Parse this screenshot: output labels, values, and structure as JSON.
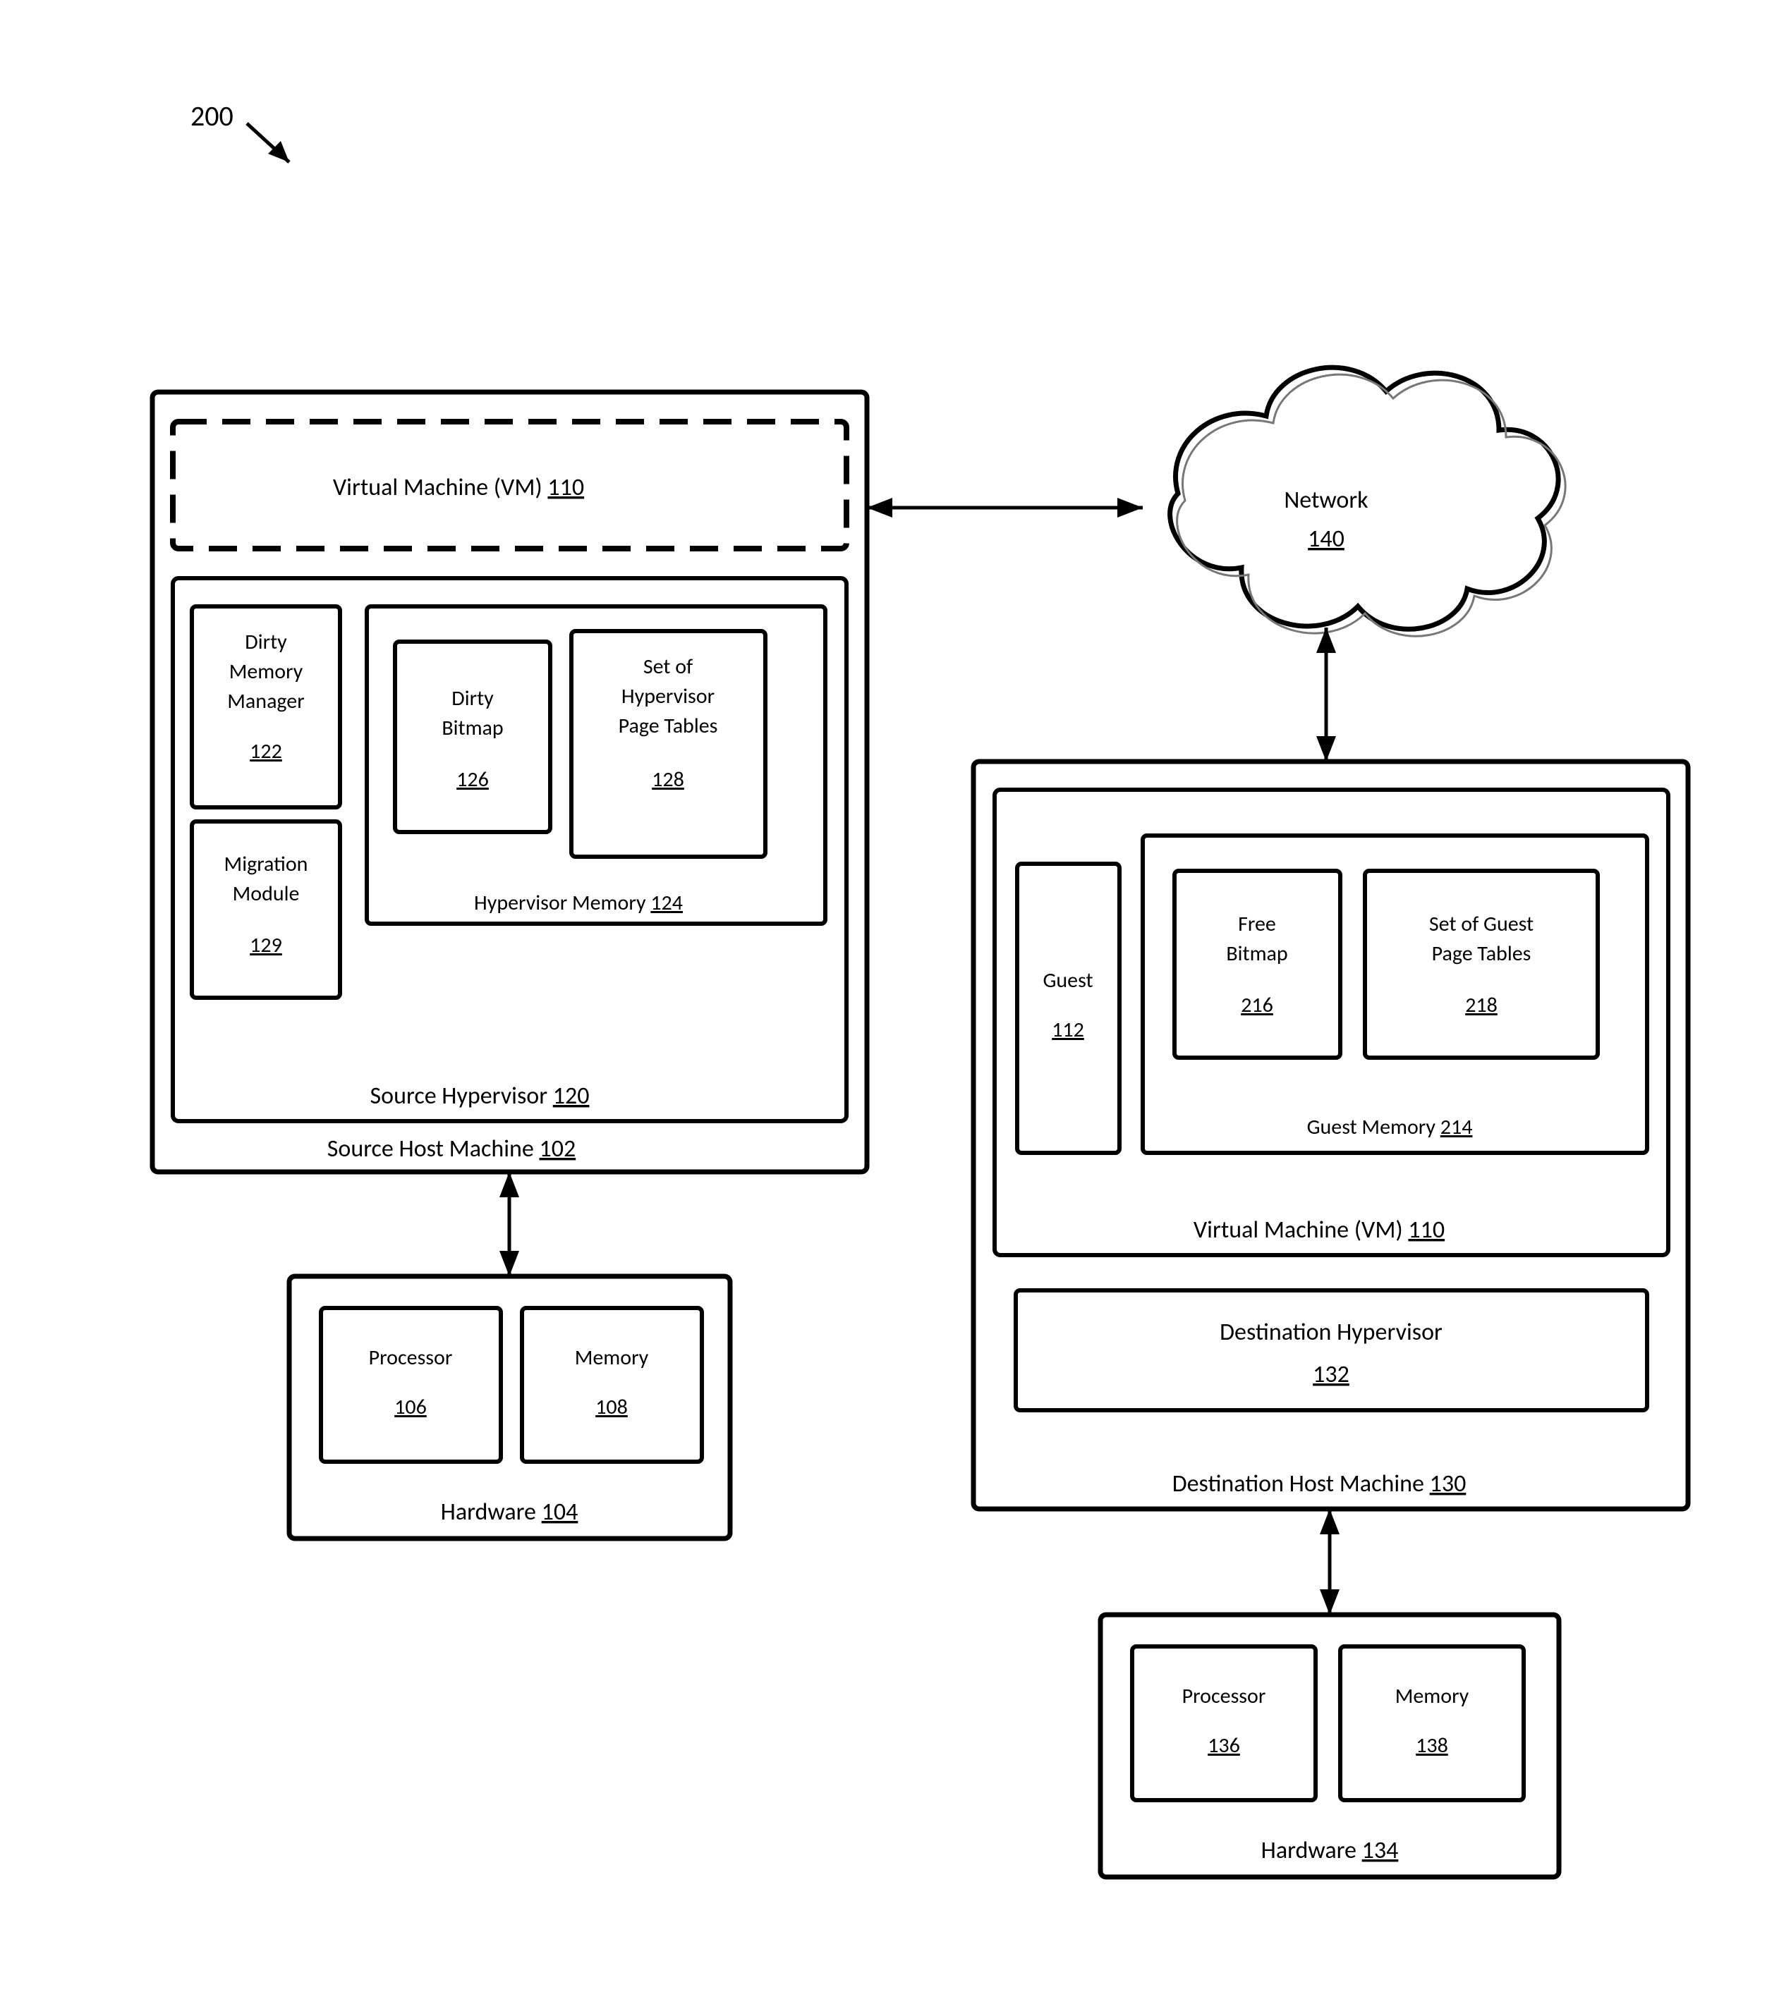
{
  "figure": {
    "label": "200"
  },
  "source_host": {
    "label": "Source Host Machine",
    "num": "102"
  },
  "vm_source": {
    "label": "Virtual Machine (VM)",
    "num": "110"
  },
  "source_hyp": {
    "label": "Source Hypervisor",
    "num": "120"
  },
  "dmm": {
    "line1": "Dirty",
    "line2": "Memory",
    "line3": "Manager",
    "num": "122"
  },
  "mig": {
    "line1": "Migration",
    "line2": "Module",
    "num": "129"
  },
  "hyp_mem": {
    "label": "Hypervisor Memory",
    "num": "124"
  },
  "dbm": {
    "line1": "Dirty",
    "line2": "Bitmap",
    "num": "126"
  },
  "hpt": {
    "line1": "Set of",
    "line2": "Hypervisor",
    "line3": "Page Tables",
    "num": "128"
  },
  "hw_src": {
    "label": "Hardware",
    "num": "104"
  },
  "proc_src": {
    "label": "Processor",
    "num": "106"
  },
  "mem_src": {
    "label": "Memory",
    "num": "108"
  },
  "network": {
    "label": "Network",
    "num": "140"
  },
  "dest_host": {
    "label": "Destination Host Machine",
    "num": "130"
  },
  "dest_hyp": {
    "line1": "Destination Hypervisor",
    "num": "132"
  },
  "vm_dest": {
    "label": "Virtual Machine (VM)",
    "num": "110"
  },
  "guest": {
    "label": "Guest",
    "num": "112"
  },
  "guest_mem": {
    "label": "Guest Memory",
    "num": "214"
  },
  "fbm": {
    "line1": "Free",
    "line2": "Bitmap",
    "num": "216"
  },
  "gpt": {
    "line1": "Set of Guest",
    "line2": "Page Tables",
    "num": "218"
  },
  "hw_dst": {
    "label": "Hardware",
    "num": "134"
  },
  "proc_dst": {
    "label": "Processor",
    "num": "136"
  },
  "mem_dst": {
    "label": "Memory",
    "num": "138"
  }
}
